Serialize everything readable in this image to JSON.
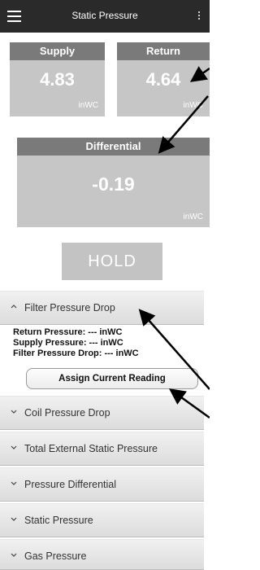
{
  "appbar": {
    "title": "Static Pressure"
  },
  "gauges": {
    "supply": {
      "label": "Supply",
      "value": "4.83",
      "unit": "inWC"
    },
    "return": {
      "label": "Return",
      "value": "4.64",
      "unit": "inWC"
    },
    "differential": {
      "label": "Differential",
      "value": "-0.19",
      "unit": "inWC"
    }
  },
  "hold_label": "HOLD",
  "accordion": {
    "filter": {
      "label": "Filter Pressure Drop",
      "lines": [
        "Return Pressure: --- inWC",
        "Supply Pressure: --- inWC",
        "Filter Pressure Drop: --- inWC"
      ],
      "button": "Assign Current Reading"
    },
    "collapsed": [
      "Coil Pressure Drop",
      "Total External Static Pressure",
      "Pressure Differential",
      "Static Pressure",
      "Gas Pressure"
    ]
  },
  "colors": {
    "appbar": "#2a2a2a",
    "gauge_header": "#7a7a7a",
    "gauge_body": "#c6c6c6",
    "annotation_arrow": "#000000"
  }
}
